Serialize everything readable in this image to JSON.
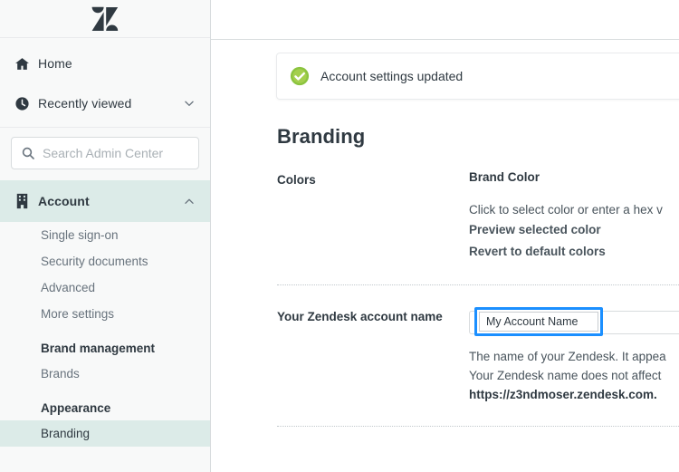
{
  "sidebar": {
    "logo": "zendesk-logo",
    "nav": [
      {
        "label": "Home",
        "icon": "home-icon"
      },
      {
        "label": "Recently viewed",
        "icon": "clock-icon",
        "chevron": "chevron-down-icon"
      }
    ],
    "search": {
      "placeholder": "Search Admin Center",
      "icon": "search-icon",
      "value": ""
    },
    "account_group": {
      "label": "Account",
      "icon": "building-icon",
      "chevron": "chevron-up-icon"
    },
    "sub_items": [
      {
        "label": "Single sign-on",
        "type": "item",
        "selected": false
      },
      {
        "label": "Security documents",
        "type": "item",
        "selected": false
      },
      {
        "label": "Advanced",
        "type": "item",
        "selected": false
      },
      {
        "label": "More settings",
        "type": "item",
        "selected": false
      },
      {
        "label": "Brand management",
        "type": "header"
      },
      {
        "label": "Brands",
        "type": "item",
        "selected": false
      },
      {
        "label": "Appearance",
        "type": "header"
      },
      {
        "label": "Branding",
        "type": "item",
        "selected": true
      }
    ]
  },
  "main": {
    "notice": {
      "text": "Account settings updated",
      "icon": "success-check-icon"
    },
    "title": "Branding",
    "colors_row": {
      "label": "Colors",
      "field_title": "Brand Color",
      "hint": "Click to select color or enter a hex v",
      "links": [
        "Preview selected color",
        "Revert to default colors"
      ]
    },
    "account_name_row": {
      "label": "Your Zendesk account name",
      "input_value": "My Account Name",
      "hint_line1": "The name of your Zendesk. It appea",
      "hint_line2": "Your Zendesk name does not affect",
      "hint_line3": "https://z3ndmoser.zendesk.com."
    }
  },
  "colors": {
    "accent_teal": "#DCEBE8",
    "focus_blue": "#1B8FFF",
    "success_green": "#8BC43F",
    "text_dark": "#2F3941",
    "text_muted": "#68737D",
    "sidebar_bg": "#F8F9F9",
    "border": "#D8DCDE"
  }
}
